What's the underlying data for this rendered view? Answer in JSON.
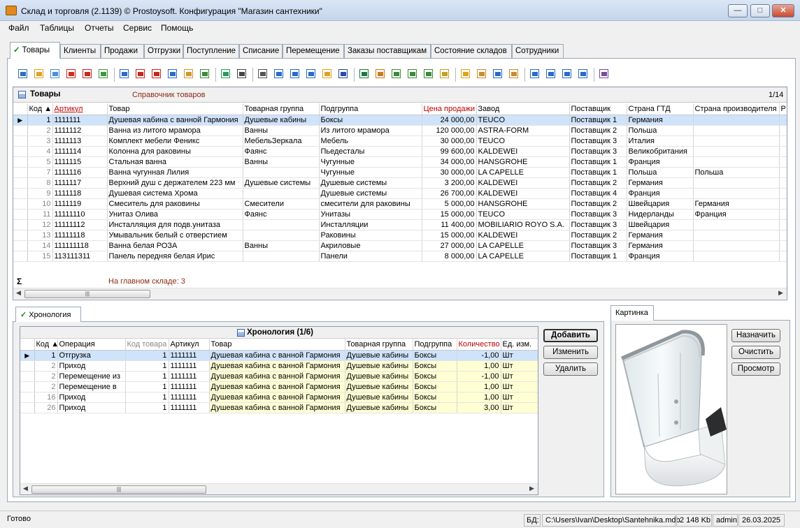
{
  "window": {
    "title": "Склад и торговля (2.1139) © Prostoysoft. Конфигурация \"Магазин сантехники\""
  },
  "menu": [
    "Файл",
    "Таблицы",
    "Отчеты",
    "Сервис",
    "Помощь"
  ],
  "tabs": [
    "Товары",
    "Клиенты",
    "Продажи",
    "Отгрузки",
    "Поступление",
    "Списание",
    "Перемещение",
    "Заказы поставщикам",
    "Состояние складов",
    "Сотрудники"
  ],
  "toolbar_icons": [
    "new-record-icon",
    "edit-icon",
    "copy-icon",
    "delete-icon",
    "delete-multiple-icon",
    "import-icon",
    "filter-icon",
    "filter-clear-icon",
    "filter-remove-icon",
    "filter-set-icon",
    "filter-tree-icon",
    "sql-icon",
    "refresh-icon",
    "find-icon",
    "print-icon",
    "preview-icon",
    "export-table-icon",
    "export-form-icon",
    "export-report-icon",
    "word-icon",
    "excel-icon",
    "export-html-icon",
    "xml-icon",
    "txt-icon",
    "csv-icon",
    "chart-icon",
    "sort-asc-icon",
    "sort-desc-icon",
    "columns-icon",
    "settings-icon",
    "first-icon",
    "prev-icon",
    "next-icon",
    "last-icon",
    "barcode-icon"
  ],
  "grid": {
    "title": "Товары",
    "subtitle": "Справочник товаров",
    "count": "1/14",
    "columns": [
      "Код",
      "Артикул",
      "Товар",
      "Товарная группа",
      "Подгруппа",
      "Цена продажи",
      "Завод",
      "Поставщик",
      "Страна ГТД",
      "Страна производителя",
      "Р"
    ],
    "rows": [
      [
        "1",
        "1111111",
        "Душевая кабина с ванной Гармония",
        "Душевые кабины",
        "Боксы",
        "24 000,00",
        "TEUCO",
        "Поставщик 1",
        "Германия",
        ""
      ],
      [
        "2",
        "1111112",
        "Ванна из литого мрамора",
        "Ванны",
        "Из литого мрамора",
        "120 000,00",
        "ASTRA-FORM",
        "Поставщик 2",
        "Польша",
        ""
      ],
      [
        "3",
        "1111113",
        "Комплект мебели Феникс",
        "МебельЗеркала",
        "Мебель",
        "30 000,00",
        "TEUCO",
        "Поставщик 3",
        "Италия",
        ""
      ],
      [
        "4",
        "1111114",
        "Колонна  для раковины",
        "Фаянс",
        "Пьедесталы",
        "99 600,00",
        "KALDEWEI",
        "Поставщик 3",
        "Великобритания",
        ""
      ],
      [
        "5",
        "1111115",
        "Стальная ванна",
        "Ванны",
        "Чугунные",
        "34 000,00",
        "HANSGROHE",
        "Поставщик 1",
        "Франция",
        ""
      ],
      [
        "7",
        "1111116",
        "Ванна чугунная Лилия",
        "",
        "Чугунные",
        "30 000,00",
        "LA CAPELLE",
        "Поставщик 1",
        "Польша",
        "Польша"
      ],
      [
        "8",
        "1111117",
        "Верхний душ с держателем 223 мм",
        "Душевые системы",
        "Душевые системы",
        "3 200,00",
        "KALDEWEI",
        "Поставщик 2",
        "Германия",
        ""
      ],
      [
        "9",
        "1111118",
        "Душевая система Хрома",
        "",
        "Душевые системы",
        "26 700,00",
        "KALDEWEI",
        "Поставщик 4",
        "Франция",
        ""
      ],
      [
        "10",
        "1111119",
        "Смеситель для раковины",
        "Смесители",
        "смесители для раковины",
        "5 000,00",
        "HANSGROHE",
        "Поставщик 2",
        "Швейцария",
        "Германия"
      ],
      [
        "11",
        "11111110",
        "Унитаз Олива",
        "Фаянс",
        "Унитазы",
        "15 000,00",
        "TEUCO",
        "Поставщик 3",
        "Нидерланды",
        "Франция"
      ],
      [
        "12",
        "11111112",
        "Инсталляция для подв.унитаза",
        "",
        "Инсталляции",
        "11 400,00",
        "MOBILIARIO ROYO S.A.",
        "Поставщик 3",
        "Швейцария",
        ""
      ],
      [
        "13",
        "11111118",
        "Умывальник белый с отверстием",
        "",
        "Раковины",
        "15 000,00",
        "KALDEWEI",
        "Поставщик 2",
        "Германия",
        ""
      ],
      [
        "14",
        "111111118",
        "Ванна белая РОЗА",
        "Ванны",
        "Акриловые",
        "27 000,00",
        "LA CAPELLE",
        "Поставщик 3",
        "Германия",
        ""
      ],
      [
        "15",
        "113111311",
        "Панель передняя белая Ирис",
        "",
        "Панели",
        "8 000,00",
        "LA CAPELLE",
        "Поставщик 1",
        "Франция",
        ""
      ]
    ],
    "sum_text": "На главном складе: 3"
  },
  "history": {
    "tab": "Хронология",
    "title": "Хронология (1/6)",
    "columns": [
      "Код",
      "Операция",
      "Код товара",
      "Артикул",
      "Товар",
      "Товарная группа",
      "Подгруппа",
      "Количество",
      "Ед. изм."
    ],
    "rows": [
      [
        "1",
        "Отгрузка",
        "1",
        "1111111",
        "Душевая кабина с ванной Гармония",
        "Душевые кабины",
        "Боксы",
        "-1,00",
        "Шт"
      ],
      [
        "2",
        "Приход",
        "1",
        "1111111",
        "Душевая кабина с ванной Гармония",
        "Душевые кабины",
        "Боксы",
        "1,00",
        "Шт"
      ],
      [
        "2",
        "Перемещение из",
        "1",
        "1111111",
        "Душевая кабина с ванной Гармония",
        "Душевые кабины",
        "Боксы",
        "-1,00",
        "Шт"
      ],
      [
        "2",
        "Перемещение в",
        "1",
        "1111111",
        "Душевая кабина с ванной Гармония",
        "Душевые кабины",
        "Боксы",
        "1,00",
        "Шт"
      ],
      [
        "16",
        "Приход",
        "1",
        "1111111",
        "Душевая кабина с ванной Гармония",
        "Душевые кабины",
        "Боксы",
        "1,00",
        "Шт"
      ],
      [
        "26",
        "Приход",
        "1",
        "1111111",
        "Душевая кабина с ванной Гармония",
        "Душевые кабины",
        "Боксы",
        "3,00",
        "Шт"
      ]
    ],
    "buttons": {
      "add": "Добавить",
      "edit": "Изменить",
      "delete": "Удалить"
    }
  },
  "picture": {
    "tab": "Картинка",
    "buttons": {
      "assign": "Назначить",
      "clear": "Очистить",
      "view": "Просмотр"
    }
  },
  "status": {
    "ready": "Готово",
    "db_label": "БД:",
    "db_path": "C:\\Users\\Ivan\\Desktop\\Santehnika.mdb",
    "size": "2 148 Kb",
    "user": "admin",
    "date": "26.03.2025"
  }
}
